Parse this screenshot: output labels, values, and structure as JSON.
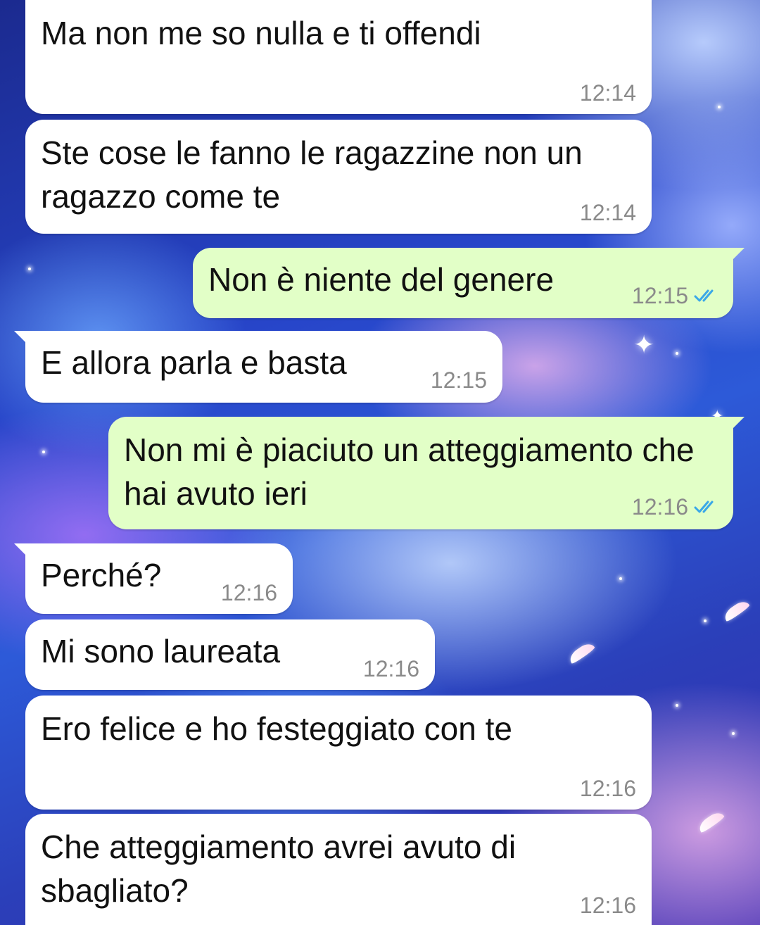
{
  "chat": {
    "messages": [
      {
        "direction": "in",
        "text": "Ma non me so nulla e ti offendi",
        "time": "12:14"
      },
      {
        "direction": "in",
        "text": "Ste cose le fanno le ragazzine non un ragazzo come te",
        "time": "12:14"
      },
      {
        "direction": "out",
        "text": "Non è niente del genere",
        "time": "12:15",
        "status": "read"
      },
      {
        "direction": "in",
        "text": "E allora parla e basta",
        "time": "12:15"
      },
      {
        "direction": "out",
        "text": "Non mi è piaciuto un atteggiamento che hai avuto ieri",
        "time": "12:16",
        "status": "read"
      },
      {
        "direction": "in",
        "text": "Perché?",
        "time": "12:16"
      },
      {
        "direction": "in",
        "text": "Mi sono laureata",
        "time": "12:16"
      },
      {
        "direction": "in",
        "text": "Ero felice e ho festeggiato con te",
        "time": "12:16"
      },
      {
        "direction": "in",
        "text": "Che atteggiamento avrei avuto di sbagliato?",
        "time": "12:16"
      }
    ]
  },
  "colors": {
    "incoming_bubble": "#ffffff",
    "outgoing_bubble": "#e2ffc7",
    "read_ticks": "#3aa8e8",
    "timestamp": "#8a8a8a"
  },
  "icons": {
    "read_status": "double-check-icon"
  }
}
